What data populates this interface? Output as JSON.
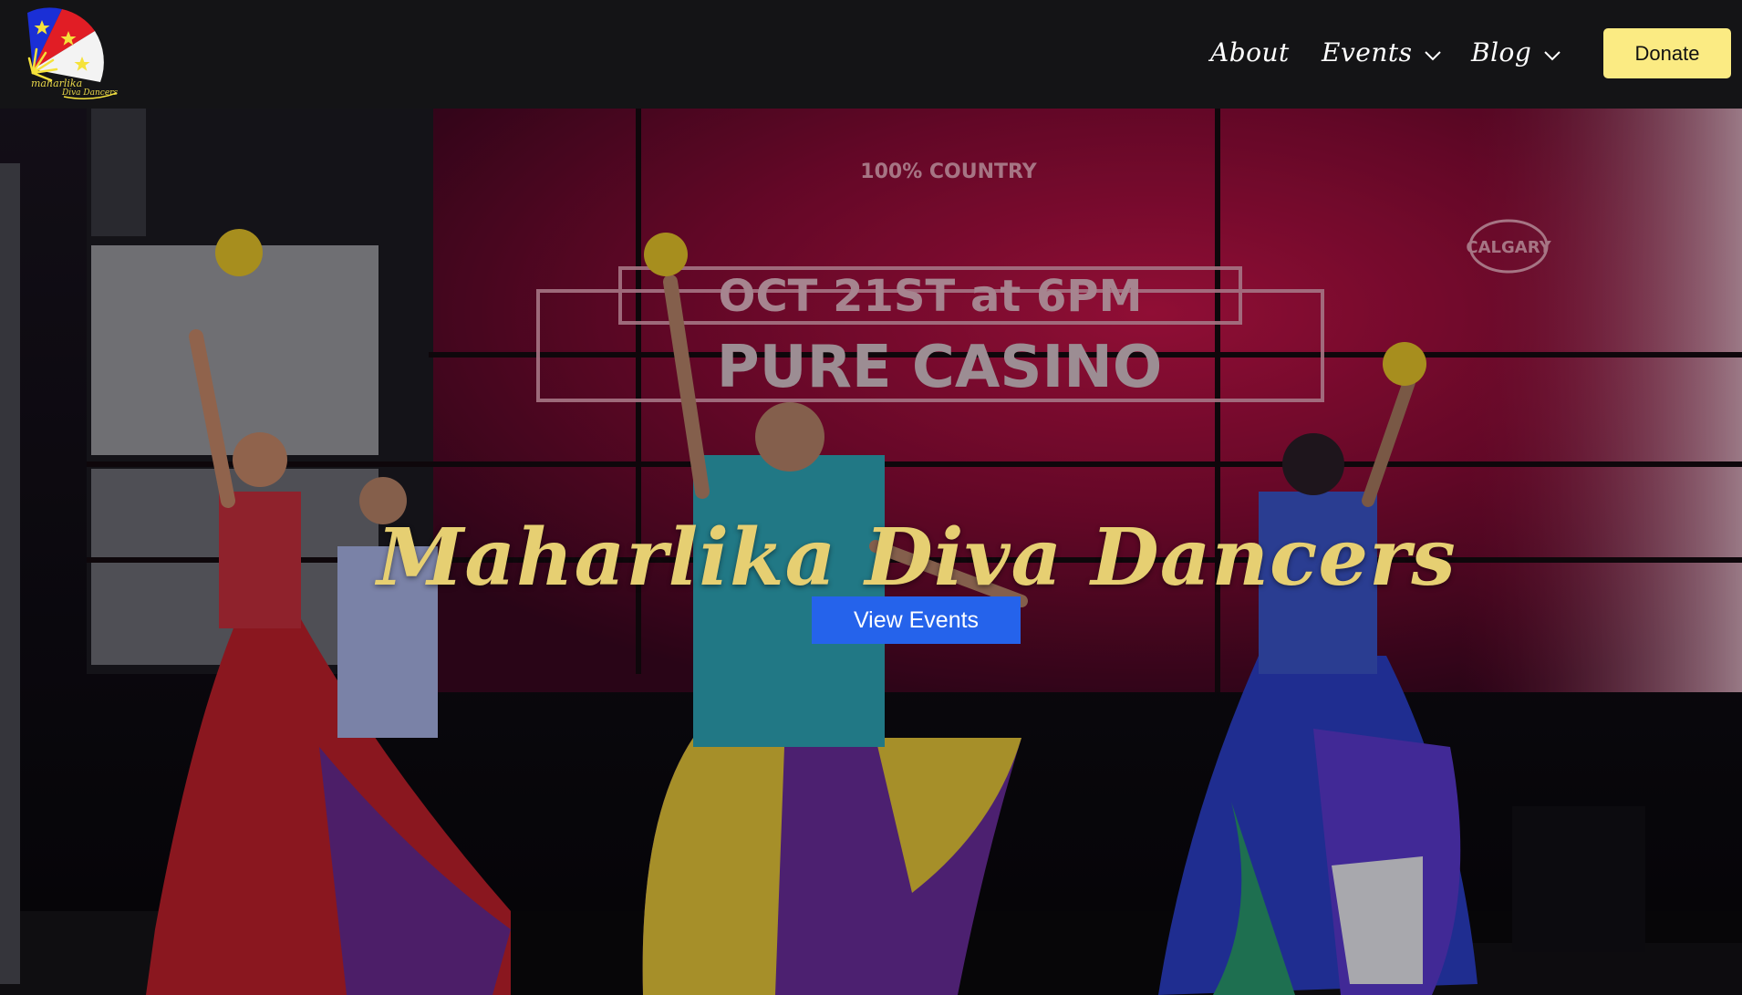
{
  "brand": {
    "logo_line1": "maharlika",
    "logo_line2": "Diva Dancers",
    "colors": {
      "blue": "#1a2fd6",
      "red": "#e11d25",
      "white": "#f3f3f3",
      "yellow": "#f5e23a"
    }
  },
  "nav": {
    "items": [
      {
        "label": "About",
        "has_dropdown": false
      },
      {
        "label": "Events",
        "has_dropdown": true
      },
      {
        "label": "Blog",
        "has_dropdown": true
      }
    ],
    "donate_label": "Donate",
    "donate_color": "#fbeb83"
  },
  "hero": {
    "title": "Maharlika Diva Dancers",
    "title_color": "#e6cf72",
    "cta_label": "View Events",
    "cta_color": "#2563eb",
    "screen_text": {
      "line1": "100% COUNTRY",
      "line2": "OCT 21ST at 6PM",
      "line3": "PURE CASINO",
      "badge": "CALGARY"
    }
  }
}
